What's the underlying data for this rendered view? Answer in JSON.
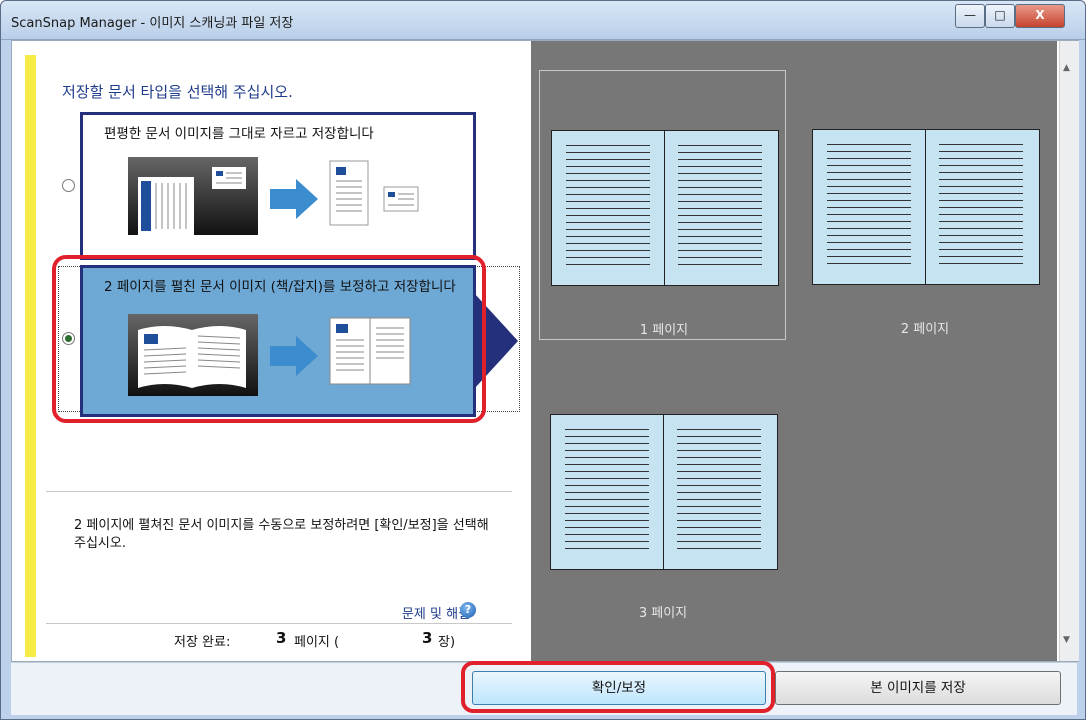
{
  "window": {
    "title": "ScanSnap Manager - 이미지 스캐닝과 파일 저장",
    "minimize_glyph": "—",
    "maximize_glyph": "□",
    "close_glyph": "X"
  },
  "left_panel": {
    "instruction": "저장할 문서 타입을 선택해 주십시오.",
    "options": [
      {
        "label": "편평한 문서 이미지를 그대로 자르고 저장합니다",
        "selected": false
      },
      {
        "label": "2 페이지를 펼친 문서 이미지 (책/잡지)를 보정하고 저장합니다",
        "selected": true
      }
    ],
    "help_note": "2 페이지에 펼쳐진 문서 이미지를 수동으로 보정하려면 [확인/보정]을 선택해 주십시오.",
    "help_link": "문제 및 해결",
    "help_icon": "?",
    "saved": {
      "label": "저장 완료:",
      "pages_value": "3",
      "pages_unit": "페이지 (",
      "sheets_value": "3",
      "sheets_unit": "장)"
    }
  },
  "preview": {
    "pages": [
      {
        "label": "1 페이지",
        "selected": true
      },
      {
        "label": "2 페이지",
        "selected": false
      },
      {
        "label": "3 페이지",
        "selected": false
      }
    ],
    "scroll_up_glyph": "▲",
    "scroll_down_glyph": "▼"
  },
  "buttons": {
    "check_correct": "확인/보정",
    "save_image": "본 이미지를 저장"
  },
  "colors": {
    "accent_red": "#e0202a",
    "option_border": "#24307c",
    "selected_option_bg": "#6ea9d6",
    "preview_bg": "#777777",
    "page_fill": "#c6e3f2",
    "highlight_bar": "#f6ec45"
  }
}
